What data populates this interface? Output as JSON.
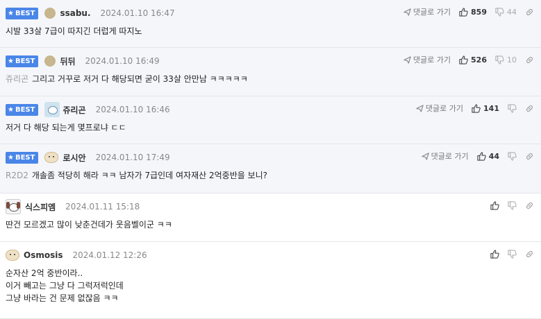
{
  "labels": {
    "best": "BEST",
    "reply": "댓글로 가기"
  },
  "comments": [
    {
      "best": true,
      "avatar": "dot",
      "nick": "ssabu.",
      "date": "2024.01.10 16:47",
      "show_reply": true,
      "up": "859",
      "down": "44",
      "target": "",
      "text": "시발 33살 7급이 따지긴 더럽게 따지노"
    },
    {
      "best": true,
      "avatar": "dot",
      "nick": "뒤뒤",
      "date": "2024.01.10 16:49",
      "show_reply": true,
      "up": "526",
      "down": "10",
      "target": "쥬리곤",
      "text": "그리고 거꾸로 저거 다 해당되면 굳이 33살 안만남 ㅋㅋㅋㅋㅋ"
    },
    {
      "best": true,
      "avatar": "cat",
      "nick": "쥬리곤",
      "date": "2024.01.10 16:46",
      "show_reply": true,
      "up": "141",
      "down": "",
      "target": "",
      "text": "저거 다 해당 되는게 몇프로냐 ㄷㄷ"
    },
    {
      "best": true,
      "avatar": "puppy",
      "nick": "로시안",
      "date": "2024.01.10 17:49",
      "show_reply": true,
      "up": "44",
      "down": "",
      "target": "R2D2",
      "text": "개솔좀 적당히 해라 ㅋㅋ 남자가 7급인데 여자재산 2억중반을 보니?"
    },
    {
      "best": false,
      "avatar": "dog",
      "nick": "식스피엠",
      "date": "2024.01.11 15:18",
      "show_reply": false,
      "up": "",
      "down": "",
      "target": "",
      "text": "딴건 모르겠고 많이 낮춘건데가 웃음벨이군 ㅋㅋ"
    },
    {
      "best": false,
      "avatar": "puppy",
      "nick": "Osmosis",
      "date": "2024.01.12 12:26",
      "show_reply": false,
      "up": "",
      "down": "",
      "target": "",
      "text": "순자산 2억 중반이라..\n이거 빼고는 그냥 다 그럭저럭인데\n그냥 바라는 건 문제 없잖음 ㅋㅋ"
    }
  ]
}
